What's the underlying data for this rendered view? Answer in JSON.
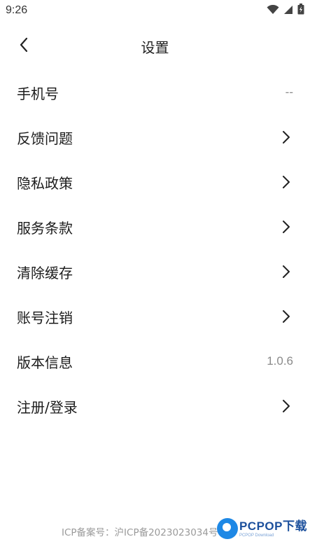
{
  "status_bar": {
    "time": "9:26"
  },
  "header": {
    "title": "设置"
  },
  "settings": [
    {
      "id": "phone",
      "label": "手机号",
      "value": "--",
      "chevron": false
    },
    {
      "id": "feedback",
      "label": "反馈问题",
      "value": "",
      "chevron": true
    },
    {
      "id": "privacy",
      "label": "隐私政策",
      "value": "",
      "chevron": true
    },
    {
      "id": "terms",
      "label": "服务条款",
      "value": "",
      "chevron": true
    },
    {
      "id": "clear-cache",
      "label": "清除缓存",
      "value": "",
      "chevron": true
    },
    {
      "id": "delete-account",
      "label": "账号注销",
      "value": "",
      "chevron": true
    },
    {
      "id": "version",
      "label": "版本信息",
      "value": "1.0.6",
      "chevron": false
    },
    {
      "id": "register-login",
      "label": "注册/登录",
      "value": "",
      "chevron": true
    }
  ],
  "footer": {
    "icp": "ICP备案号：沪ICP备2023023034号",
    "watermark_main": "PCPOP下载",
    "watermark_sub": "PCPOP Download"
  },
  "icons": {
    "back": "chevron-left-icon",
    "row_arrow": "chevron-right-icon",
    "wifi": "wifi-icon",
    "signal": "signal-icon",
    "battery": "battery-icon"
  }
}
